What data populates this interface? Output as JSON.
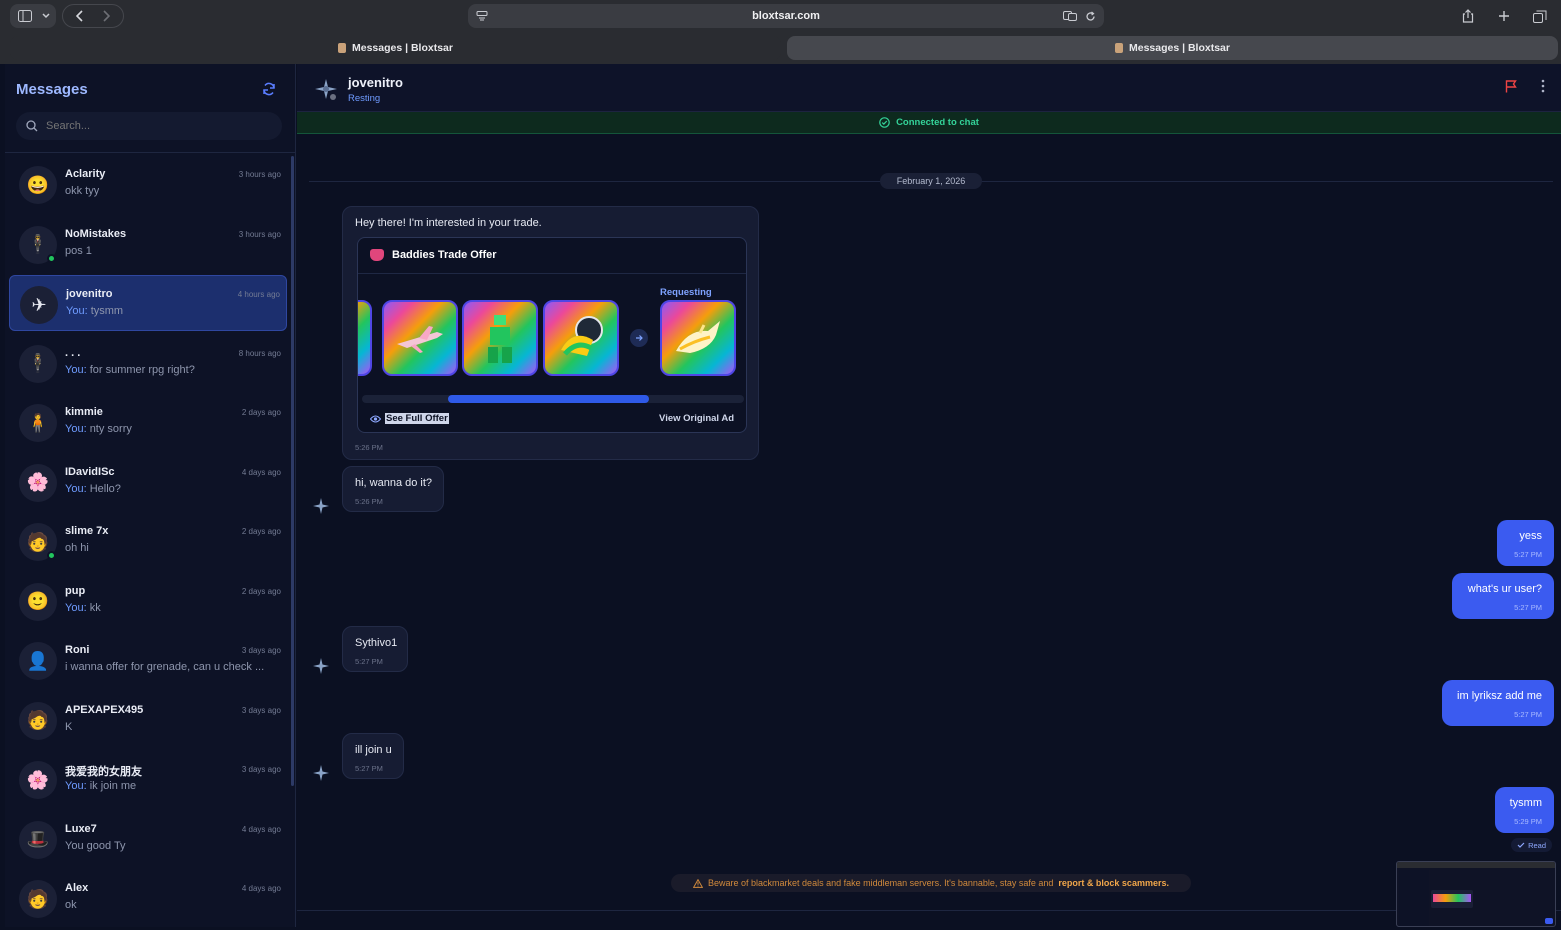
{
  "browser": {
    "url": "bloxtsar.com",
    "tabs": [
      {
        "title": "Messages | Bloxtsar"
      },
      {
        "title": "Messages | Bloxtsar"
      }
    ]
  },
  "sidebar": {
    "title": "Messages",
    "search_placeholder": "Search...",
    "conversations": [
      {
        "name": "Aclarity",
        "you": "",
        "preview": "okk tyy",
        "time": "3 hours ago",
        "online": false,
        "avatar": "😀"
      },
      {
        "name": "NoMistakes",
        "you": "",
        "preview": "pos 1",
        "time": "3 hours ago",
        "online": true,
        "avatar": "🕴"
      },
      {
        "name": "jovenitro",
        "you": "You:",
        "preview": "tysmm",
        "time": "4 hours ago",
        "online": false,
        "avatar": "✈"
      },
      {
        "name": ". . .",
        "you": "You:",
        "preview": "for summer rpg right?",
        "time": "8 hours ago",
        "online": false,
        "avatar": "🕴"
      },
      {
        "name": "kimmie",
        "you": "You:",
        "preview": "nty sorry",
        "time": "2 days ago",
        "online": false,
        "avatar": "🧍"
      },
      {
        "name": "IDavidISc",
        "you": "You:",
        "preview": "Hello?",
        "time": "4 days ago",
        "online": false,
        "avatar": "🌸"
      },
      {
        "name": "slime 7x",
        "you": "",
        "preview": "oh hi",
        "time": "2 days ago",
        "online": true,
        "avatar": "🧑"
      },
      {
        "name": "pup",
        "you": "You:",
        "preview": "kk",
        "time": "2 days ago",
        "online": false,
        "avatar": "🙂"
      },
      {
        "name": "Roni",
        "you": "",
        "preview": "i wanna offer for grenade, can u check ...",
        "time": "3 days ago",
        "online": false,
        "avatar": "👤"
      },
      {
        "name": "APEXAPEX495",
        "you": "",
        "preview": "K",
        "time": "3 days ago",
        "online": false,
        "avatar": "🧑"
      },
      {
        "name": "我爱我的女朋友",
        "you": "You:",
        "preview": "ik join me",
        "time": "3 days ago",
        "online": false,
        "avatar": "🌸"
      },
      {
        "name": "Luxe7",
        "you": "",
        "preview": "You good Ty",
        "time": "4 days ago",
        "online": false,
        "avatar": "🎩"
      },
      {
        "name": "Alex",
        "you": "",
        "preview": "ok",
        "time": "4 days ago",
        "online": false,
        "avatar": "🧑"
      }
    ]
  },
  "chat": {
    "username": "jovenitro",
    "status": "Resting",
    "connected_text": "Connected to chat",
    "date_divider": "February 1, 2026",
    "trade_message": {
      "text": "Hey there! I'm interested in your trade.",
      "card_title": "Baddies Trade Offer",
      "requesting_label": "Requesting",
      "offered_items": [
        "airplane-item",
        "dragon-item",
        "rainbow-item"
      ],
      "requested_items": [
        "unicorn-item"
      ],
      "scroll_position": 0.25,
      "see_full": "See Full Offer",
      "view_original": "View Original Ad",
      "time": "5:26 PM"
    },
    "incoming": [
      {
        "text": "hi, wanna do it?",
        "time": "5:26 PM"
      },
      {
        "text": "Sythivo1",
        "time": "5:27 PM"
      },
      {
        "text": "ill join u",
        "time": "5:27 PM"
      }
    ],
    "outgoing": [
      {
        "text": "yess",
        "time": "5:27 PM"
      },
      {
        "text": "what's ur user?",
        "time": "5:27 PM"
      },
      {
        "text": "im lyriksz add me",
        "time": "5:27 PM"
      },
      {
        "text": "tysmm",
        "time": "5:29 PM"
      }
    ],
    "read_receipt": "Read",
    "warning_text": "Beware of blackmarket deals and fake middleman servers. It's bannable, stay safe and",
    "warning_link": "report & block scammers."
  },
  "colors": {
    "accent": "#3b5bf0",
    "online": "#22c55e",
    "connected": "#34d399",
    "flag": "#ef4444",
    "warning": "#d18a3c"
  }
}
